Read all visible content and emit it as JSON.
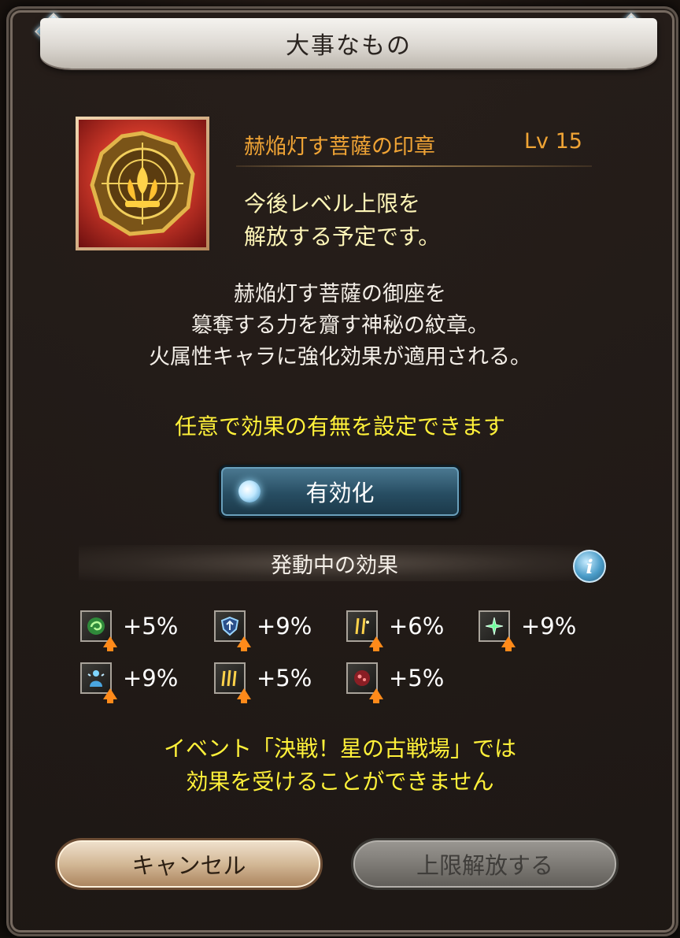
{
  "dialog": {
    "title": "大事なもの"
  },
  "item": {
    "name": "赫焔灯す菩薩の印章",
    "level": "Lv 15",
    "limit_note": [
      "今後レベル上限を",
      "解放する予定です。"
    ],
    "description": [
      "赫焔灯す菩薩の御座を",
      "簒奪する力を齎す神秘の紋章。",
      "火属性キャラに強化効果が適用される。"
    ]
  },
  "setting_note": "任意で効果の有無を設定できます",
  "toggle": {
    "label": "有効化",
    "state": "on"
  },
  "effects_header": "発動中の効果",
  "effects": [
    {
      "icon": "green-swirl-icon",
      "value": "+5%"
    },
    {
      "icon": "shield-up-icon",
      "value": "+9%"
    },
    {
      "icon": "double-sparkle-icon",
      "value": "+6%"
    },
    {
      "icon": "green-star-icon",
      "value": "+9%"
    },
    {
      "icon": "heal-figure-icon",
      "value": "+9%"
    },
    {
      "icon": "triple-sparkle-icon",
      "value": "+5%"
    },
    {
      "icon": "red-orb-icon",
      "value": "+5%"
    }
  ],
  "event_note": [
    "イベント「決戦！星の古戦場」では",
    "効果を受けることができません"
  ],
  "buttons": {
    "cancel": "キャンセル",
    "limit_break": "上限解放する"
  },
  "colors": {
    "accent_orange": "#f0a435",
    "note_yellow": "#fff13a",
    "limit_yellow": "#fff6b8",
    "buff_arrow": "#ff8a1a"
  }
}
